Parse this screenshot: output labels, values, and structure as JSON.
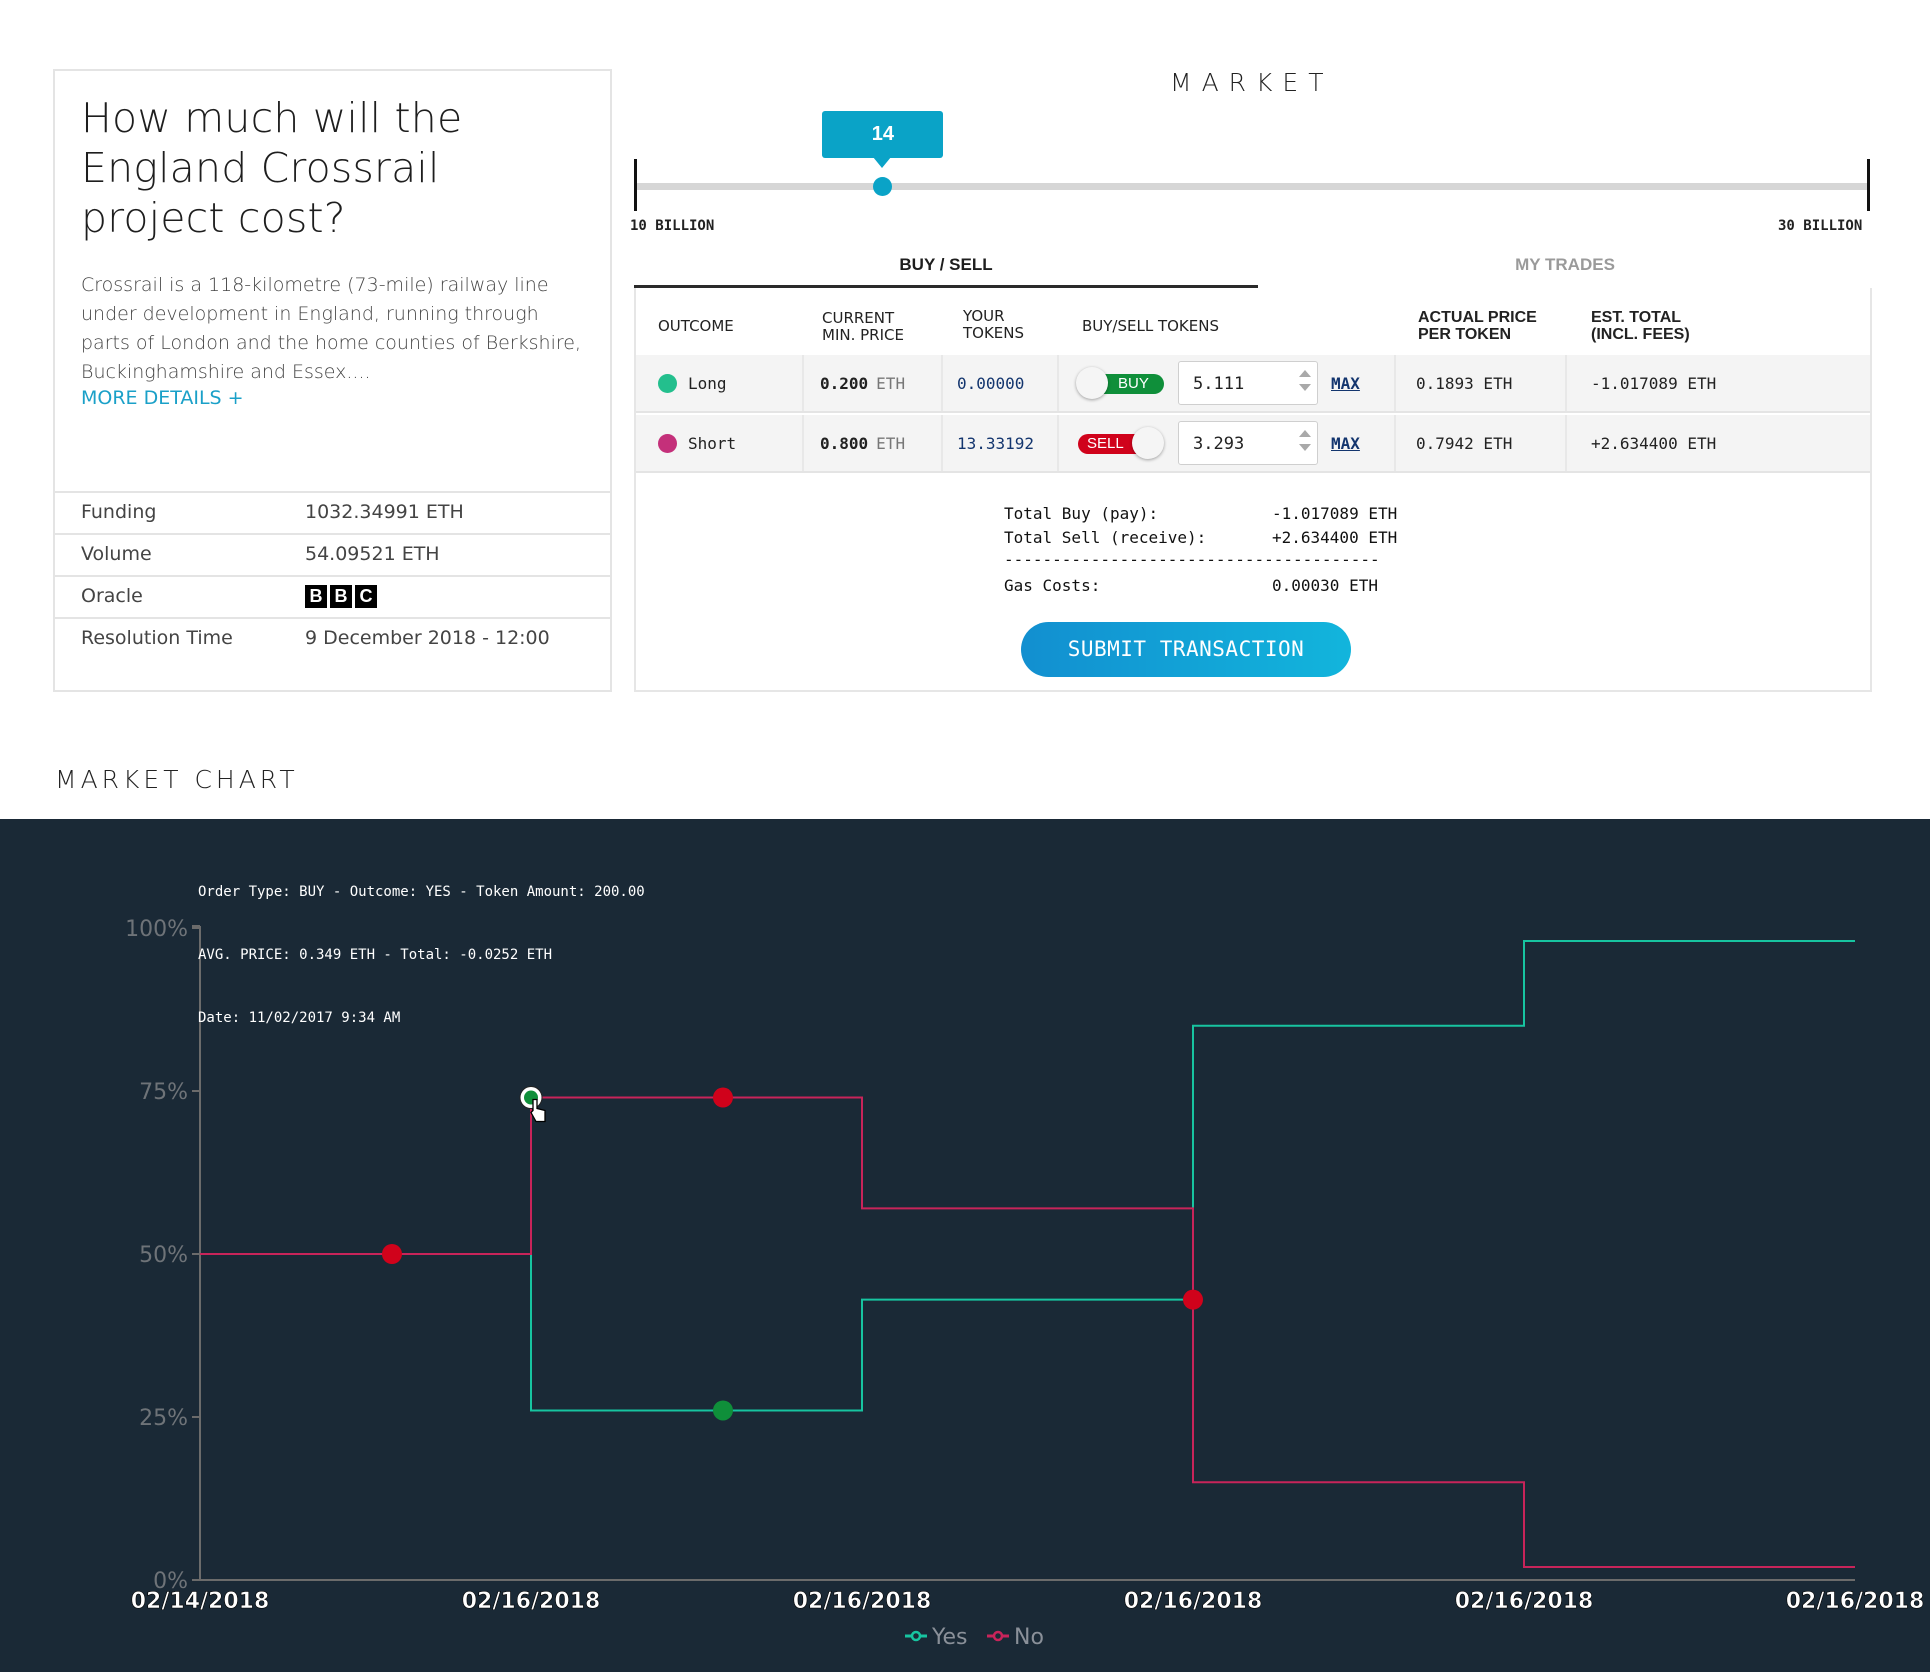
{
  "question": {
    "title": "How much will the England Crossrail project cost?",
    "description": "Crossrail is a 118-kilometre (73-mile) railway line under development in England, running through parts of London and the home counties of Berkshire, Buckinghamshire and Essex....",
    "more_details": "MORE DETAILS +"
  },
  "info": [
    {
      "label": "Funding",
      "value": "1032.34991 ETH"
    },
    {
      "label": "Volume",
      "value": "54.09521 ETH"
    },
    {
      "label": "Oracle",
      "value": "",
      "logo": [
        "B",
        "B",
        "C"
      ]
    },
    {
      "label": "Resolution Time",
      "value": "9 December 2018 - 12:00"
    }
  ],
  "market": {
    "title": "MARKET",
    "slider": {
      "value_label": "14",
      "value": 14,
      "min": 10,
      "max": 30,
      "min_label": "10 BILLION",
      "max_label": "30 BILLION"
    },
    "tabs": [
      {
        "label": "BUY / SELL",
        "active": true
      },
      {
        "label": "MY TRADES",
        "active": false
      }
    ],
    "columns": [
      "OUTCOME",
      "CURRENT MIN. PRICE",
      "YOUR TOKENS",
      "BUY/SELL TOKENS",
      "ACTUAL PRICE PER TOKEN",
      "EST. TOTAL (INCL. FEES)"
    ],
    "column_lines": {
      "current_1": "CURRENT",
      "current_2": "MIN. PRICE",
      "your_1": "YOUR",
      "your_2": "TOKENS",
      "actual_1": "ACTUAL PRICE",
      "actual_2": "PER TOKEN",
      "est_1": "EST. TOTAL",
      "est_2": "(INCL. FEES)"
    },
    "rows": [
      {
        "outcome": "Long",
        "color": "#23bf8d",
        "min_price": "0.200",
        "min_price_unit": "ETH",
        "your_tokens": "0.00000",
        "mode": "BUY",
        "mode_color": "#0f8f3a",
        "amount": "5.111",
        "max": "MAX",
        "actual_price": "0.1893 ETH",
        "est_total": "-1.017089 ETH"
      },
      {
        "outcome": "Short",
        "color": "#c4307a",
        "min_price": "0.800",
        "min_price_unit": "ETH",
        "your_tokens": "13.33192",
        "mode": "SELL",
        "mode_color": "#d0021b",
        "amount": "3.293",
        "max": "MAX",
        "actual_price": "0.7942 ETH",
        "est_total": "+2.634400 ETH"
      }
    ],
    "summary": {
      "total_buy_label": "Total Buy (pay):",
      "total_buy_value": "-1.017089 ETH",
      "total_sell_label": "Total Sell (receive):",
      "total_sell_value": "+2.634400 ETH",
      "divider": "---------------------------------------",
      "gas_label": "Gas Costs:",
      "gas_value": "0.00030 ETH"
    },
    "submit_label": "SUBMIT TRANSACTION"
  },
  "chart_section": {
    "title": "MARKET CHART",
    "tooltip": {
      "line1": "Order Type: BUY - Outcome: YES - Token Amount: 200.00",
      "line2": "AVG. PRICE: 0.349 ETH - Total: -0.0252 ETH",
      "line3": "Date: 11/02/2017 9:34 AM"
    }
  },
  "chart_data": {
    "type": "line",
    "step": true,
    "title": "",
    "xlabel": "",
    "ylabel": "",
    "x_ticks": [
      "02/14/2018",
      "02/16/2018",
      "02/16/2018",
      "02/16/2018",
      "02/16/2018",
      "02/16/2018"
    ],
    "y_ticks": [
      "0%",
      "25%",
      "50%",
      "75%",
      "100%"
    ],
    "ylim": [
      0,
      100
    ],
    "grid": false,
    "legend": "bottom-center",
    "background": "#1a2936",
    "series": [
      {
        "name": "Yes",
        "color": "#17c4a0",
        "marker_color": "#0f8f3a",
        "values": [
          50,
          26,
          43,
          85,
          98
        ],
        "markers": [
          {
            "segment": 1,
            "value": 26
          },
          {
            "segment": 1,
            "value": 74,
            "at_start": true,
            "highlighted": true
          }
        ]
      },
      {
        "name": "No",
        "color": "#c8245a",
        "marker_color": "#d0021b",
        "values": [
          50,
          74,
          57,
          15,
          2
        ],
        "markers": [
          {
            "segment": 0,
            "value": 50
          },
          {
            "segment": 1,
            "value": 74
          },
          {
            "segment": 3,
            "value": 43,
            "at_start": true
          }
        ]
      }
    ]
  }
}
